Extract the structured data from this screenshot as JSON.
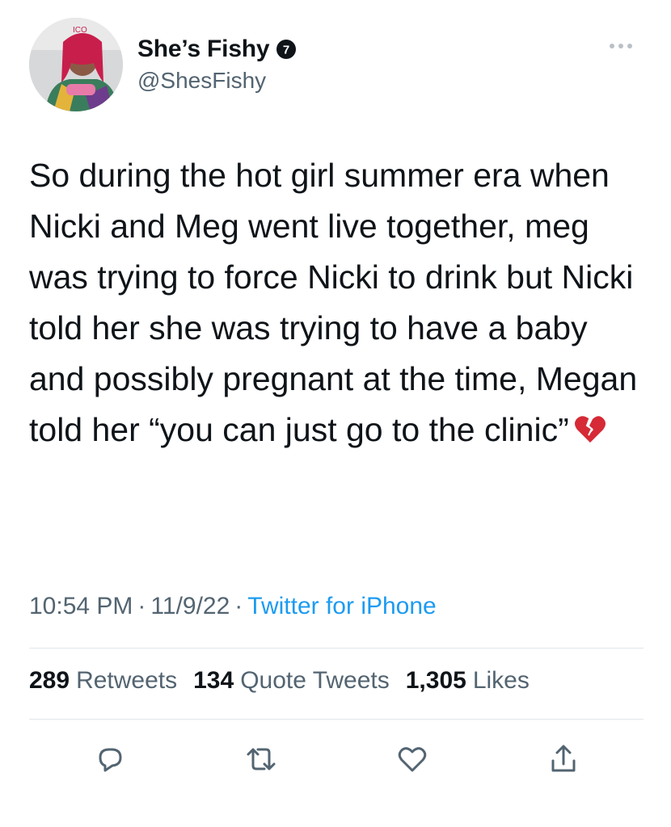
{
  "user": {
    "display_name": "She’s Fishy",
    "handle": "@ShesFishy",
    "avatar_icon": "profile-photo",
    "verified_icon": "verified-badge-icon"
  },
  "tweet": {
    "text": "So during the hot girl summer era when Nicki and Meg went live together, meg was trying to force Nicki to drink but Nicki told her she was trying to have a baby and possibly pregnant at the time, Megan told her “you can just go to the clinic”",
    "emoji": "broken-heart-emoji"
  },
  "meta": {
    "time": "10:54 PM",
    "date": "11/9/22",
    "source": "Twitter for iPhone",
    "separator": "·"
  },
  "stats": {
    "retweets_count": "289",
    "retweets_label": "Retweets",
    "quotes_count": "134",
    "quotes_label": "Quote Tweets",
    "likes_count": "1,305",
    "likes_label": "Likes"
  },
  "actions": [
    {
      "name": "reply",
      "icon": "reply-icon"
    },
    {
      "name": "retweet",
      "icon": "retweet-icon"
    },
    {
      "name": "like",
      "icon": "heart-icon"
    },
    {
      "name": "share",
      "icon": "share-icon"
    }
  ],
  "colors": {
    "text": "#0f1419",
    "secondary": "#536471",
    "link": "#1d9bf0",
    "divider": "#e1e6ea"
  }
}
